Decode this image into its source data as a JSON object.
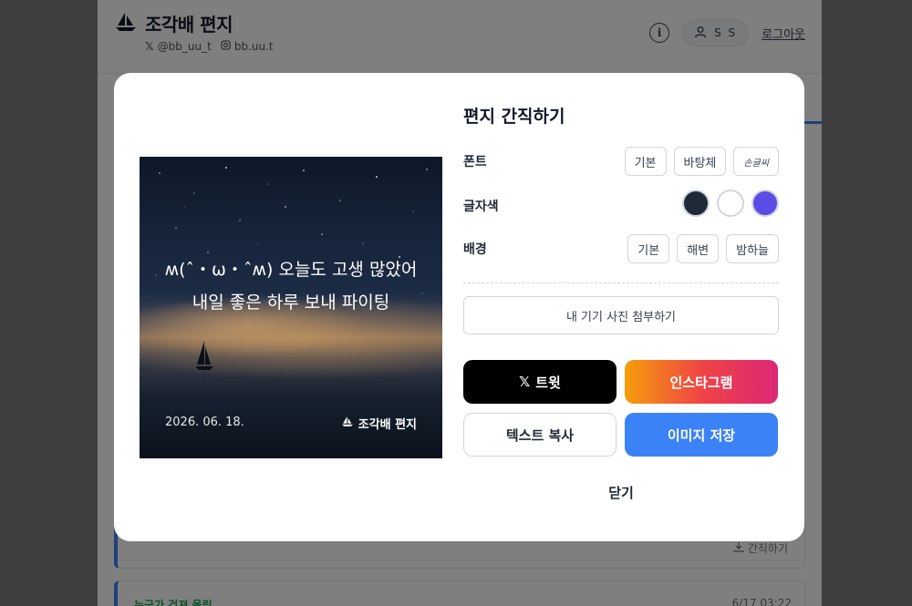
{
  "app": {
    "title": "조각배 편지",
    "social": {
      "x_handle": "@bb_uu_t",
      "instagram_handle": "bb.uu.t"
    },
    "user_initials": "S S",
    "logout_label": "로그아웃",
    "info_icon_glyph": "i"
  },
  "background_cards": [
    {
      "action_label": "간직하기"
    },
    {
      "tag": "누군가 건져 올림",
      "time": "6/17 03:22"
    }
  ],
  "modal": {
    "title": "편지 간직하기",
    "preview": {
      "text": "ʍ(ˆ・ω・ˆʍ) 오늘도 고생 많았어 내일 좋은 하루 보내 파이팅",
      "date": "2026. 06. 18.",
      "brand": "조각배 편지"
    },
    "font": {
      "label": "폰트",
      "options": [
        "기본",
        "바탕체",
        "손글씨"
      ]
    },
    "text_color": {
      "label": "글자색",
      "swatches": [
        "#1f2937",
        "#ffffff",
        "#5b4ce6"
      ]
    },
    "background": {
      "label": "배경",
      "options": [
        "기본",
        "해변",
        "밤하늘"
      ]
    },
    "attach_photo_label": "내 기기 사진 첨부하기",
    "tweet_label": "트윗",
    "instagram_label": "인스타그램",
    "copy_text_label": "텍스트 복사",
    "save_image_label": "이미지 저장",
    "close_label": "닫기"
  }
}
